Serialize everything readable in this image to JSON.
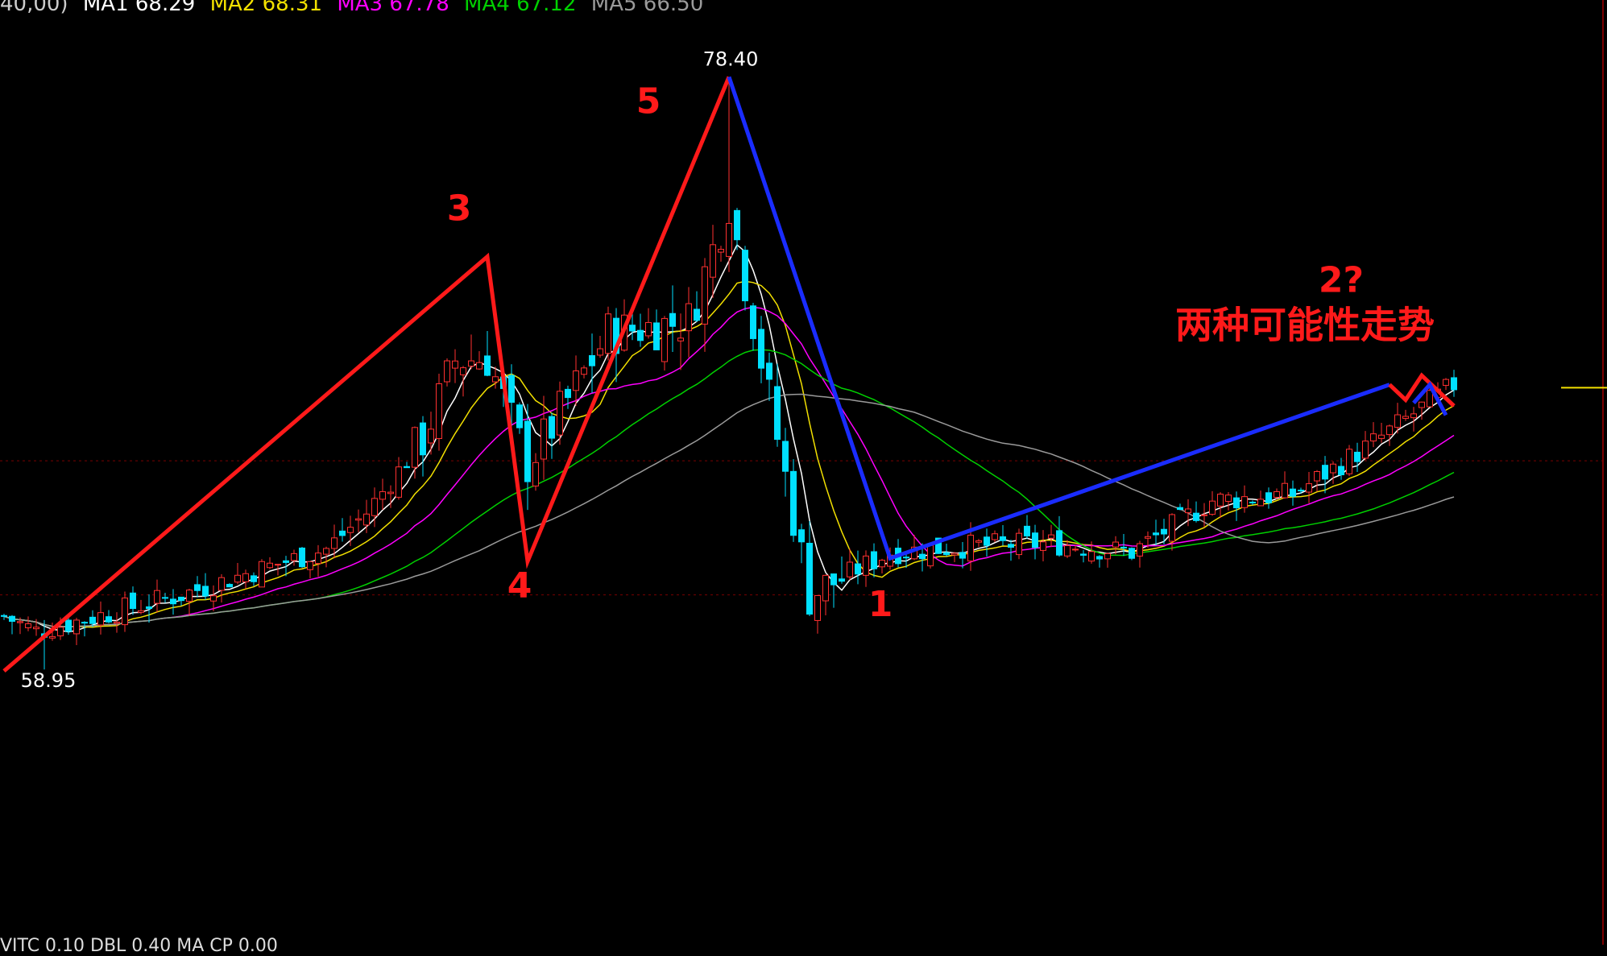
{
  "header": {
    "prefix": "40,00)",
    "ma": [
      {
        "label": "MA1 68.29",
        "color": "#ffffff"
      },
      {
        "label": "MA2 68.31",
        "color": "#f2e000"
      },
      {
        "label": "MA3 67.78",
        "color": "#ff00ff"
      },
      {
        "label": "MA4 67.12",
        "color": "#00d000"
      },
      {
        "label": "MA5 66.50",
        "color": "#9a9a9a"
      }
    ]
  },
  "footer": {
    "text": "VITC 0.10 DBL 0.40 MA CP 0.00"
  },
  "chart_data": {
    "type": "line",
    "title": "",
    "ylim": [
      57,
      80
    ],
    "price_high": 78.4,
    "price_low": 58.95,
    "high_label": "78.40",
    "low_label": "58.95",
    "wave_labels": [
      "3",
      "4",
      "5",
      "1",
      "2?"
    ],
    "annotation": "两种可能性走势",
    "series": [
      {
        "name": "",
        "color": "#ff1a1a",
        "points": [
          [
            0,
            58.9
          ],
          [
            60,
            72.5
          ],
          [
            65,
            62.5
          ],
          [
            90,
            78.4
          ]
        ]
      },
      {
        "name": "",
        "color": "#1a2cff",
        "points": [
          [
            90,
            78.4
          ],
          [
            110,
            62.6
          ],
          [
            172,
            68.3
          ]
        ]
      },
      {
        "name": "",
        "color": "#ff1a1a",
        "points": [
          [
            172,
            68.3
          ],
          [
            174,
            67.8
          ],
          [
            176,
            68.6
          ],
          [
            180,
            67.6
          ]
        ]
      },
      {
        "name": "",
        "color": "#1a2cff",
        "points": [
          [
            175,
            67.7
          ],
          [
            177,
            68.3
          ],
          [
            179,
            67.3
          ]
        ]
      }
    ],
    "colors": {
      "up": "#ff3030",
      "down": "#00e0ff"
    }
  }
}
